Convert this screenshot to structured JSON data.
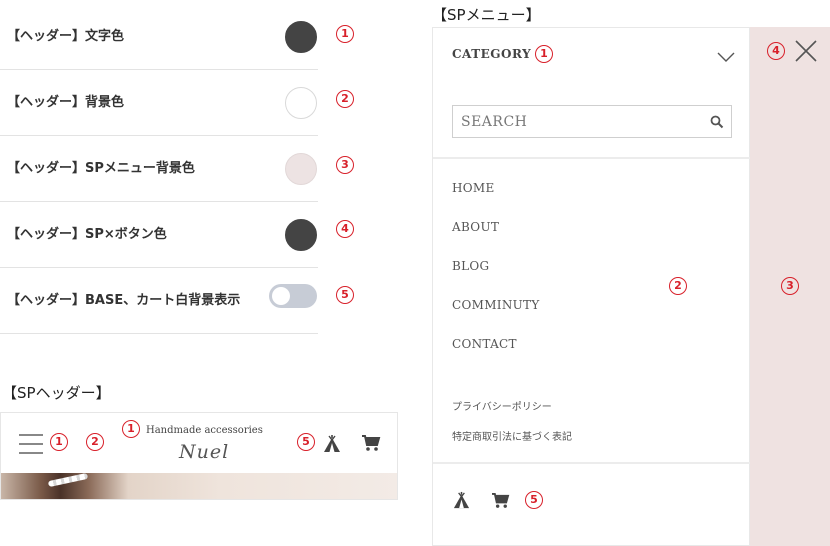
{
  "settings": {
    "rows": [
      {
        "label": "【ヘッダー】文字色",
        "type": "color",
        "color": "#444444",
        "num": "1"
      },
      {
        "label": "【ヘッダー】背景色",
        "type": "color",
        "color": "#ffffff",
        "num": "2"
      },
      {
        "label": "【ヘッダー】SPメニュー背景色",
        "type": "color",
        "color": "#ede3e3",
        "num": "3"
      },
      {
        "label": "【ヘッダー】SP×ボタン色",
        "type": "color",
        "color": "#444444",
        "num": "4"
      },
      {
        "label": "【ヘッダー】BASE、カート白背景表示",
        "type": "toggle",
        "value": false,
        "num": "5"
      }
    ]
  },
  "sp_header": {
    "title": "【SPヘッダー】",
    "brand_top": "Handmade accessories",
    "brand_script": "Nuel",
    "marker_1a": "1",
    "marker_2": "2",
    "marker_1b": "1",
    "marker_5": "5"
  },
  "sp_menu": {
    "title": "【SPメニュー】",
    "category": "CATEGORY",
    "search_placeholder": "SEARCH",
    "nav": [
      "HOME",
      "ABOUT",
      "BLOG",
      "COMMINUTY",
      "CONTACT"
    ],
    "links": [
      "プライバシーポリシー",
      "特定商取引法に基づく表記"
    ],
    "marker_1": "1",
    "marker_2": "2",
    "marker_3": "3",
    "marker_4": "4",
    "marker_5": "5",
    "overlay_color": "#efe2e1"
  },
  "colors": {
    "marker": "#d8202a"
  }
}
